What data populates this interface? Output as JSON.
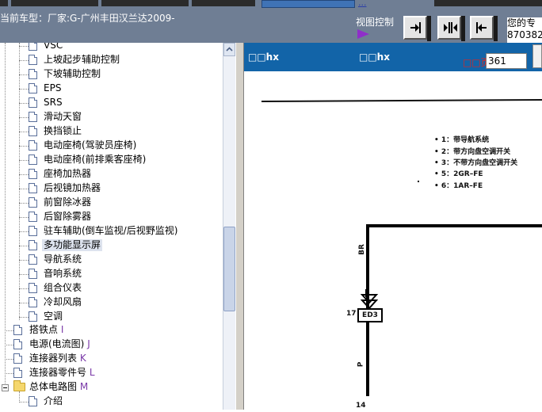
{
  "header": {
    "car_model_label": "当前车型：",
    "car_model_value": "厂家:G-广州丰田汉兰达2009-",
    "link_dots": "...",
    "view_control_label": "视图控制",
    "right_info_line1": "您的专",
    "right_info_line2": "870382"
  },
  "tree": {
    "items": [
      {
        "label": "VSC",
        "key": ""
      },
      {
        "label": "上坡起步辅助控制",
        "key": ""
      },
      {
        "label": "下坡辅助控制",
        "key": ""
      },
      {
        "label": "EPS",
        "key": ""
      },
      {
        "label": "SRS",
        "key": ""
      },
      {
        "label": "滑动天窗",
        "key": ""
      },
      {
        "label": "换挡锁止",
        "key": ""
      },
      {
        "label": "电动座椅(驾驶员座椅)",
        "key": ""
      },
      {
        "label": "电动座椅(前排乘客座椅)",
        "key": ""
      },
      {
        "label": "座椅加热器",
        "key": ""
      },
      {
        "label": "后视镜加热器",
        "key": ""
      },
      {
        "label": "前窗除冰器",
        "key": ""
      },
      {
        "label": "后窗除雾器",
        "key": ""
      },
      {
        "label": "驻车辅助(倒车监视/后视野监视)",
        "key": ""
      },
      {
        "label": "多功能显示屏",
        "key": ""
      },
      {
        "label": "导航系统",
        "key": ""
      },
      {
        "label": "音响系统",
        "key": ""
      },
      {
        "label": "组合仪表",
        "key": ""
      },
      {
        "label": "冷却风扇",
        "key": ""
      },
      {
        "label": "空调",
        "key": ""
      }
    ],
    "top_items": [
      {
        "label": "搭铁点",
        "key": "I"
      },
      {
        "label": "电源(电流图)",
        "key": "J"
      },
      {
        "label": "连接器列表",
        "key": "K"
      },
      {
        "label": "连接器零件号",
        "key": "L"
      }
    ],
    "folder": {
      "label": "总体电路图",
      "key": "M"
    },
    "folder_child": {
      "label": "介绍",
      "key": ""
    }
  },
  "viewer": {
    "title_1": "□□hx",
    "title_2": "□□hx",
    "page_label": "□□页",
    "page_value": "361"
  },
  "diagram": {
    "legend": [
      "• 1：带导航系统",
      "• 2：带方向盘空调开关",
      "• 3：不带方向盘空调开关",
      "• 5：2GR–FE",
      "• 6：1AR–FE"
    ],
    "wire_br": "BR",
    "wire_p": "P",
    "connector": "ED3",
    "pin_17": "17",
    "pin_14": "14"
  }
}
